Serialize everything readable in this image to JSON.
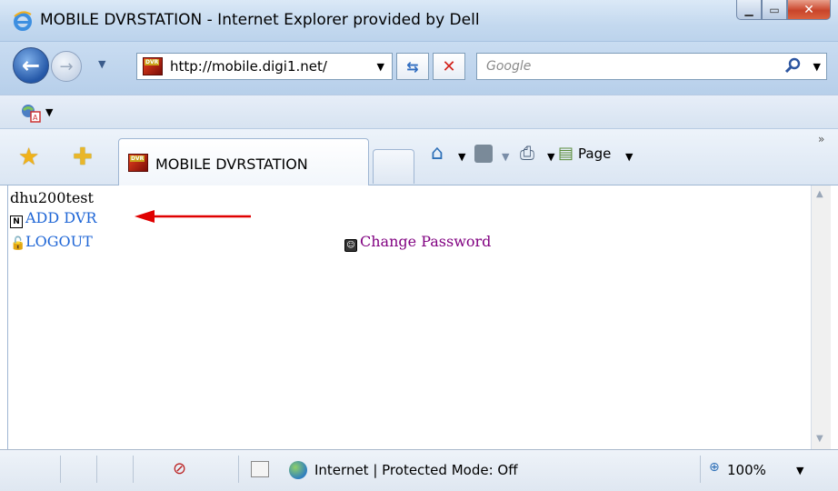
{
  "window": {
    "title": "MOBILE DVRSTATION - Internet Explorer provided by Dell"
  },
  "navbar": {
    "address": "http://mobile.digi1.net/",
    "search_placeholder": "Google",
    "favicon_text": "DVR"
  },
  "tabs": {
    "active_label": "MOBILE DVRSTATION",
    "page_menu_label": "Page"
  },
  "content": {
    "username": "dhu200test",
    "add_dvr_label": "ADD DVR",
    "logout_label": "LOGOUT",
    "change_password_label": "Change Password"
  },
  "statusbar": {
    "zone_text": "Internet | Protected Mode: Off",
    "zoom": "100%"
  },
  "colors": {
    "link": "#1f66d6",
    "visited_link": "#800080",
    "annotation_arrow": "#e00000"
  }
}
